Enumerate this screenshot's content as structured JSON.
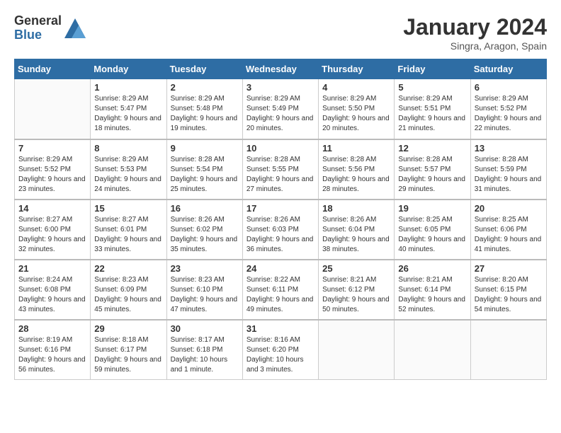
{
  "logo": {
    "general": "General",
    "blue": "Blue"
  },
  "title": "January 2024",
  "location": "Singra, Aragon, Spain",
  "weekdays": [
    "Sunday",
    "Monday",
    "Tuesday",
    "Wednesday",
    "Thursday",
    "Friday",
    "Saturday"
  ],
  "weeks": [
    [
      {
        "day": "",
        "sunrise": "",
        "sunset": "",
        "daylight": ""
      },
      {
        "day": "1",
        "sunrise": "Sunrise: 8:29 AM",
        "sunset": "Sunset: 5:47 PM",
        "daylight": "Daylight: 9 hours and 18 minutes."
      },
      {
        "day": "2",
        "sunrise": "Sunrise: 8:29 AM",
        "sunset": "Sunset: 5:48 PM",
        "daylight": "Daylight: 9 hours and 19 minutes."
      },
      {
        "day": "3",
        "sunrise": "Sunrise: 8:29 AM",
        "sunset": "Sunset: 5:49 PM",
        "daylight": "Daylight: 9 hours and 20 minutes."
      },
      {
        "day": "4",
        "sunrise": "Sunrise: 8:29 AM",
        "sunset": "Sunset: 5:50 PM",
        "daylight": "Daylight: 9 hours and 20 minutes."
      },
      {
        "day": "5",
        "sunrise": "Sunrise: 8:29 AM",
        "sunset": "Sunset: 5:51 PM",
        "daylight": "Daylight: 9 hours and 21 minutes."
      },
      {
        "day": "6",
        "sunrise": "Sunrise: 8:29 AM",
        "sunset": "Sunset: 5:52 PM",
        "daylight": "Daylight: 9 hours and 22 minutes."
      }
    ],
    [
      {
        "day": "7",
        "sunrise": "Sunrise: 8:29 AM",
        "sunset": "Sunset: 5:52 PM",
        "daylight": "Daylight: 9 hours and 23 minutes."
      },
      {
        "day": "8",
        "sunrise": "Sunrise: 8:29 AM",
        "sunset": "Sunset: 5:53 PM",
        "daylight": "Daylight: 9 hours and 24 minutes."
      },
      {
        "day": "9",
        "sunrise": "Sunrise: 8:28 AM",
        "sunset": "Sunset: 5:54 PM",
        "daylight": "Daylight: 9 hours and 25 minutes."
      },
      {
        "day": "10",
        "sunrise": "Sunrise: 8:28 AM",
        "sunset": "Sunset: 5:55 PM",
        "daylight": "Daylight: 9 hours and 27 minutes."
      },
      {
        "day": "11",
        "sunrise": "Sunrise: 8:28 AM",
        "sunset": "Sunset: 5:56 PM",
        "daylight": "Daylight: 9 hours and 28 minutes."
      },
      {
        "day": "12",
        "sunrise": "Sunrise: 8:28 AM",
        "sunset": "Sunset: 5:57 PM",
        "daylight": "Daylight: 9 hours and 29 minutes."
      },
      {
        "day": "13",
        "sunrise": "Sunrise: 8:28 AM",
        "sunset": "Sunset: 5:59 PM",
        "daylight": "Daylight: 9 hours and 31 minutes."
      }
    ],
    [
      {
        "day": "14",
        "sunrise": "Sunrise: 8:27 AM",
        "sunset": "Sunset: 6:00 PM",
        "daylight": "Daylight: 9 hours and 32 minutes."
      },
      {
        "day": "15",
        "sunrise": "Sunrise: 8:27 AM",
        "sunset": "Sunset: 6:01 PM",
        "daylight": "Daylight: 9 hours and 33 minutes."
      },
      {
        "day": "16",
        "sunrise": "Sunrise: 8:26 AM",
        "sunset": "Sunset: 6:02 PM",
        "daylight": "Daylight: 9 hours and 35 minutes."
      },
      {
        "day": "17",
        "sunrise": "Sunrise: 8:26 AM",
        "sunset": "Sunset: 6:03 PM",
        "daylight": "Daylight: 9 hours and 36 minutes."
      },
      {
        "day": "18",
        "sunrise": "Sunrise: 8:26 AM",
        "sunset": "Sunset: 6:04 PM",
        "daylight": "Daylight: 9 hours and 38 minutes."
      },
      {
        "day": "19",
        "sunrise": "Sunrise: 8:25 AM",
        "sunset": "Sunset: 6:05 PM",
        "daylight": "Daylight: 9 hours and 40 minutes."
      },
      {
        "day": "20",
        "sunrise": "Sunrise: 8:25 AM",
        "sunset": "Sunset: 6:06 PM",
        "daylight": "Daylight: 9 hours and 41 minutes."
      }
    ],
    [
      {
        "day": "21",
        "sunrise": "Sunrise: 8:24 AM",
        "sunset": "Sunset: 6:08 PM",
        "daylight": "Daylight: 9 hours and 43 minutes."
      },
      {
        "day": "22",
        "sunrise": "Sunrise: 8:23 AM",
        "sunset": "Sunset: 6:09 PM",
        "daylight": "Daylight: 9 hours and 45 minutes."
      },
      {
        "day": "23",
        "sunrise": "Sunrise: 8:23 AM",
        "sunset": "Sunset: 6:10 PM",
        "daylight": "Daylight: 9 hours and 47 minutes."
      },
      {
        "day": "24",
        "sunrise": "Sunrise: 8:22 AM",
        "sunset": "Sunset: 6:11 PM",
        "daylight": "Daylight: 9 hours and 49 minutes."
      },
      {
        "day": "25",
        "sunrise": "Sunrise: 8:21 AM",
        "sunset": "Sunset: 6:12 PM",
        "daylight": "Daylight: 9 hours and 50 minutes."
      },
      {
        "day": "26",
        "sunrise": "Sunrise: 8:21 AM",
        "sunset": "Sunset: 6:14 PM",
        "daylight": "Daylight: 9 hours and 52 minutes."
      },
      {
        "day": "27",
        "sunrise": "Sunrise: 8:20 AM",
        "sunset": "Sunset: 6:15 PM",
        "daylight": "Daylight: 9 hours and 54 minutes."
      }
    ],
    [
      {
        "day": "28",
        "sunrise": "Sunrise: 8:19 AM",
        "sunset": "Sunset: 6:16 PM",
        "daylight": "Daylight: 9 hours and 56 minutes."
      },
      {
        "day": "29",
        "sunrise": "Sunrise: 8:18 AM",
        "sunset": "Sunset: 6:17 PM",
        "daylight": "Daylight: 9 hours and 59 minutes."
      },
      {
        "day": "30",
        "sunrise": "Sunrise: 8:17 AM",
        "sunset": "Sunset: 6:18 PM",
        "daylight": "Daylight: 10 hours and 1 minute."
      },
      {
        "day": "31",
        "sunrise": "Sunrise: 8:16 AM",
        "sunset": "Sunset: 6:20 PM",
        "daylight": "Daylight: 10 hours and 3 minutes."
      },
      {
        "day": "",
        "sunrise": "",
        "sunset": "",
        "daylight": ""
      },
      {
        "day": "",
        "sunrise": "",
        "sunset": "",
        "daylight": ""
      },
      {
        "day": "",
        "sunrise": "",
        "sunset": "",
        "daylight": ""
      }
    ]
  ]
}
